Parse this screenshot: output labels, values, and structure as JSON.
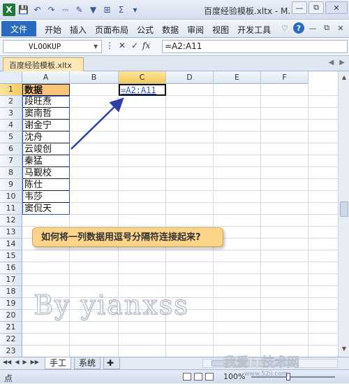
{
  "window": {
    "title": "百度经验模板.xltx - M.",
    "app_icon": "X"
  },
  "ribbon": {
    "file_label": "文件",
    "tabs": [
      "开始",
      "插入",
      "页面布局",
      "公式",
      "数据",
      "审阅",
      "视图",
      "开发工具"
    ]
  },
  "formula_bar": {
    "name_box": "VLOOKUP",
    "fx": "fx",
    "formula": "=A2:A11"
  },
  "workbook": {
    "tab_label": "百度经验模板.xltx"
  },
  "grid": {
    "columns": [
      "A",
      "B",
      "C",
      "D",
      "E",
      "F"
    ],
    "active_column": "C",
    "rows": [
      "1",
      "2",
      "3",
      "4",
      "5",
      "6",
      "7",
      "8",
      "9",
      "10",
      "11",
      "12",
      "13",
      "14",
      "15",
      "16",
      "17",
      "18",
      "19",
      "20",
      "21",
      "22",
      "23"
    ],
    "active_row": "1",
    "a_header": "数据",
    "a_values": [
      "段旺焘",
      "窦南哲",
      "谢金宁",
      "沈舟",
      "云竣创",
      "秦猛",
      "马觐校",
      "陈仕",
      "韦莎",
      "窦侃天"
    ],
    "c1_formula": "=A2:A11"
  },
  "callout": {
    "text": "如何将一列数据用逗号分隔符连接起来?"
  },
  "watermark": {
    "text": "By yianxss"
  },
  "sheets": {
    "tabs": [
      "手工",
      "系统"
    ],
    "active": "手工"
  },
  "status": {
    "mode": "点",
    "zoom": "100%"
  },
  "site": {
    "brand": "我爱IT技术网",
    "url": "www.52ij.com"
  },
  "colors": {
    "header_fill": "#f9c47a",
    "selection": "#3356d8",
    "callout_fill": "#fbd389",
    "file_tab": "#2b6bbf"
  }
}
